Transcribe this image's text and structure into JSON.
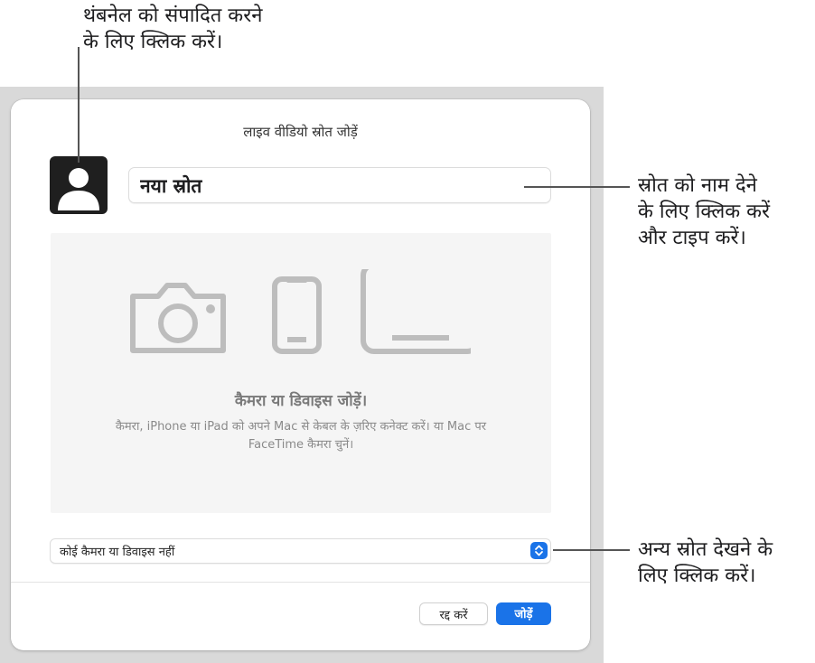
{
  "callouts": {
    "thumbnail": [
      "थंबनेल को संपादित करने",
      "के लिए क्लिक करें।"
    ],
    "name": [
      "स्रोत को नाम देने",
      "के लिए क्लिक करें",
      "और टाइप करें।"
    ],
    "sources": [
      "अन्य स्रोत देखने के",
      "लिए क्लिक करें।"
    ]
  },
  "dialog": {
    "title": "लाइव वीडियो स्रोत जोड़ें",
    "avatar_icon": "person-silhouette-icon",
    "name_value": "नया स्रोत",
    "preview": {
      "icons": [
        "camera-icon",
        "iphone-icon",
        "ipad-icon"
      ],
      "heading": "कैमरा या डिवाइस जोड़ें।",
      "description": "कैमरा, iPhone या iPad को अपने Mac से केबल के ज़रिए कनेक्ट करें। या Mac पर FaceTime कैमरा चुनें।"
    },
    "source_select": {
      "value": "कोई कैमरा या डिवाइस नहीं",
      "icon": "chevron-up-down-icon"
    },
    "buttons": {
      "cancel": "रद्द करें",
      "add": "जोड़ें"
    }
  },
  "colors": {
    "accent": "#1a73e8",
    "backdrop": "#d9d9d9",
    "preview_bg": "#f5f5f5",
    "icon_gray": "#bdbdbd"
  }
}
